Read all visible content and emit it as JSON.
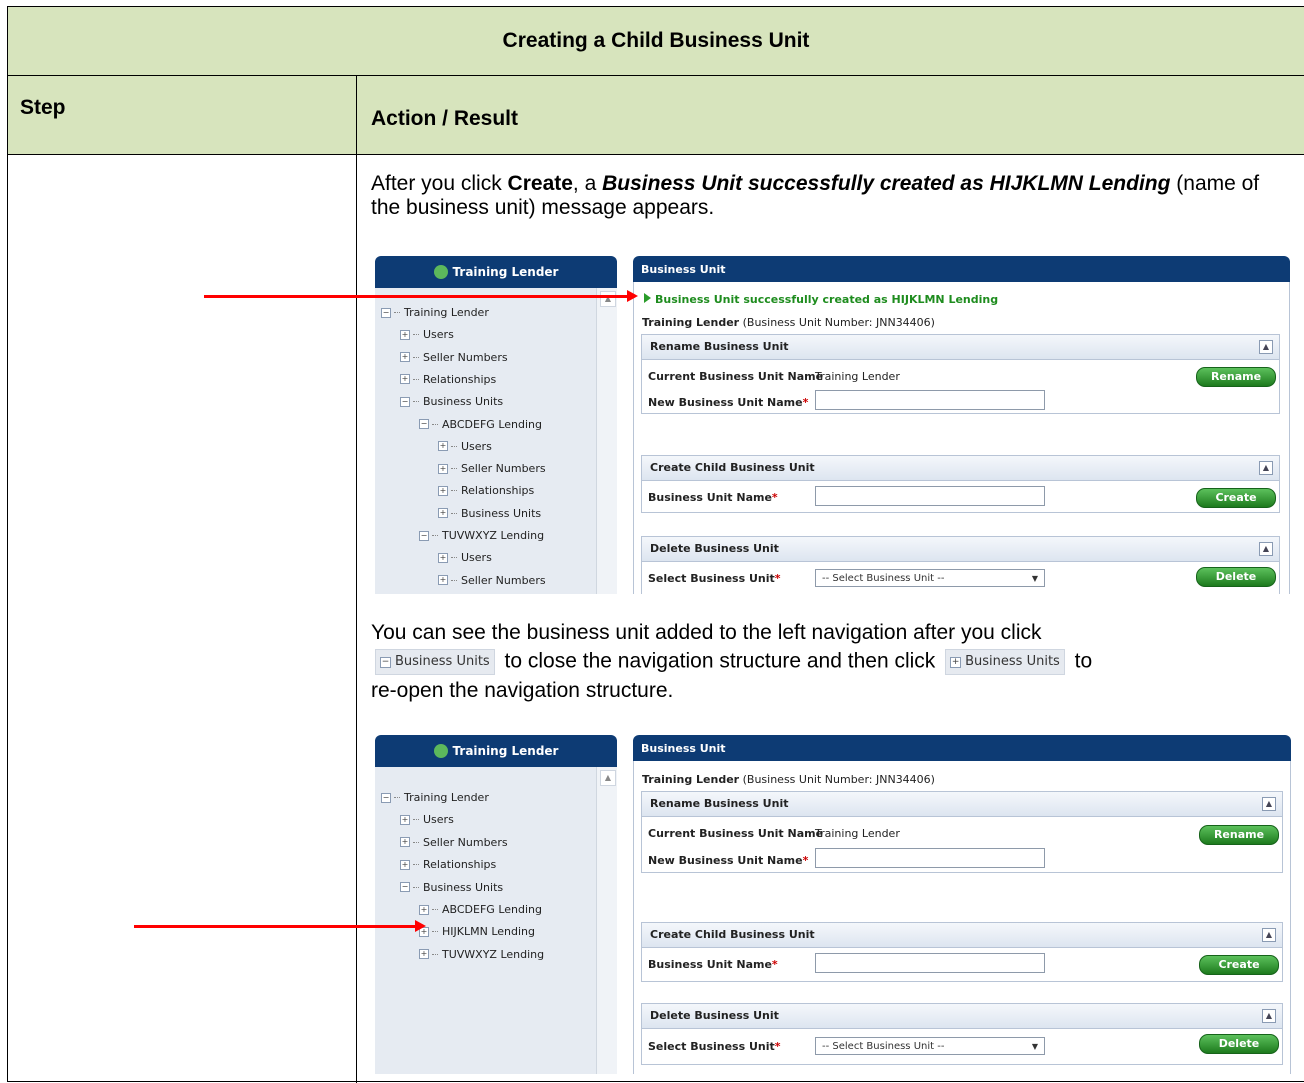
{
  "title": "Creating a Child Business Unit",
  "headers": {
    "step": "Step",
    "action": "Action / Result"
  },
  "para1": {
    "t1": "After you click ",
    "b1": "Create",
    "t2": ", a ",
    "bi": "Business Unit successfully created as HIJKLMN Lending",
    "t3": " (name of the business unit) message appears."
  },
  "para2": {
    "t1": "You can see the business unit added to the left navigation after you click",
    "chip1": "Business Units",
    "t2": " to close the navigation structure and then click ",
    "chip2": "Business Units",
    "t3": " to",
    "t4": "re-open the navigation structure."
  },
  "shot1": {
    "nav_title": "Training Lender",
    "tree": [
      "Training Lender",
      "Users",
      "Seller Numbers",
      "Relationships",
      "Business Units",
      "ABCDEFG Lending",
      "Users",
      "Seller Numbers",
      "Relationships",
      "Business Units",
      "TUVWXYZ Lending",
      "Users",
      "Seller Numbers"
    ],
    "panel_title": "Business Unit",
    "success": "Business Unit successfully created as HIJKLMN Lending",
    "bu_name": "Training Lender",
    "bu_number": " (Business Unit Number: JNN34406)",
    "rename_title": "Rename Business Unit",
    "current_label": "Current Business Unit Name",
    "current_value": "Training Lender",
    "rename_btn": "Rename",
    "new_label": "New Business Unit Name",
    "create_title": "Create Child Business Unit",
    "bu_label": "Business Unit Name",
    "create_btn": "Create",
    "delete_title": "Delete Business Unit",
    "select_label": "Select Business Unit",
    "select_value": "-- Select Business Unit --",
    "delete_btn": "Delete"
  },
  "shot2": {
    "nav_title": "Training Lender",
    "tree": [
      "Training Lender",
      "Users",
      "Seller Numbers",
      "Relationships",
      "Business Units",
      "ABCDEFG Lending",
      "HIJKLMN Lending",
      "TUVWXYZ Lending"
    ],
    "panel_title": "Business Unit",
    "bu_name": "Training Lender",
    "bu_number": " (Business Unit Number: JNN34406)",
    "rename_title": "Rename Business Unit",
    "current_label": "Current Business Unit Name",
    "current_value": "Training Lender",
    "rename_btn": "Rename",
    "new_label": "New Business Unit Name",
    "create_title": "Create Child Business Unit",
    "bu_label": "Business Unit Name",
    "create_btn": "Create",
    "delete_title": "Delete Business Unit",
    "select_label": "Select Business Unit",
    "select_value": "-- Select Business Unit --",
    "delete_btn": "Delete"
  },
  "required_mark": "*",
  "icons": {
    "collapse": "−",
    "expand": "+",
    "caret": "▼",
    "scroll_up": "▲"
  },
  "colors": {
    "header_bg": "#d7e4bd",
    "nav_blue": "#0d3b74",
    "success_green": "#1e8c1e",
    "arrow_red": "#ff0000"
  }
}
